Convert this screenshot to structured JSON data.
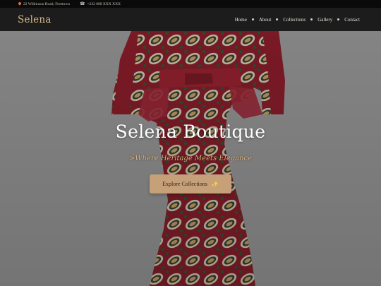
{
  "topbar": {
    "address": "22 Wilkinson Road, Freetown",
    "phone": "+232 088 XXX XXX"
  },
  "nav": {
    "brand": "Selena",
    "items": [
      {
        "label": "Home"
      },
      {
        "label": "About"
      },
      {
        "label": "Collections"
      },
      {
        "label": "Gallery"
      },
      {
        "label": "Contact"
      }
    ]
  },
  "hero": {
    "title": "Selena Boutique",
    "subtitle": "Where Heritage Meets Elegance",
    "cta_label": "Explore Collections",
    "cta_icon": "✨"
  },
  "colors": {
    "accent": "#d9b98b",
    "button": "#c6a079",
    "dress_red": "#8a1f2b"
  }
}
